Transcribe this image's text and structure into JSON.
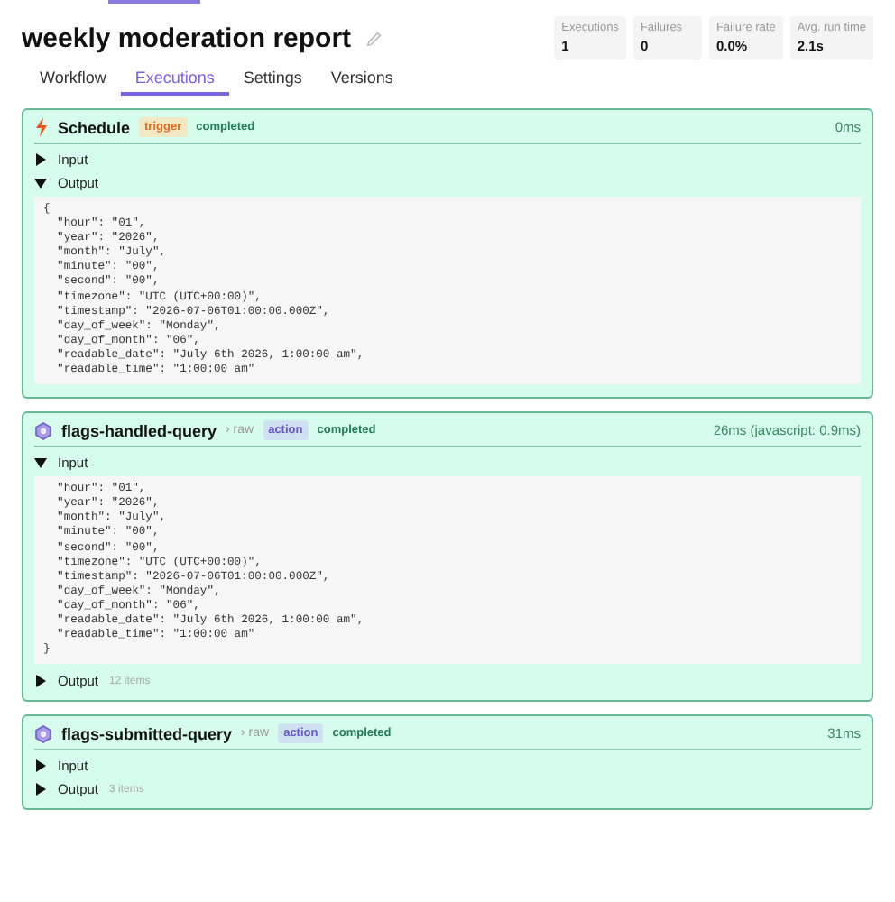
{
  "title": "weekly moderation report",
  "stats": [
    {
      "label": "Executions",
      "value": "1"
    },
    {
      "label": "Failures",
      "value": "0"
    },
    {
      "label": "Failure rate",
      "value": "0.0%"
    },
    {
      "label": "Avg. run time",
      "value": "2.1s"
    }
  ],
  "tabs": [
    {
      "label": "Workflow",
      "selected": false
    },
    {
      "label": "Executions",
      "selected": true
    },
    {
      "label": "Settings",
      "selected": false
    },
    {
      "label": "Versions",
      "selected": false
    }
  ],
  "steps": [
    {
      "kind": "trigger",
      "name": "Schedule",
      "badge": "trigger",
      "status": "completed",
      "duration": "0ms",
      "sections": [
        {
          "label": "Input",
          "expanded": false
        },
        {
          "label": "Output",
          "expanded": true,
          "code": [
            "{",
            "  \"hour\": \"01\",",
            "  \"year\": \"2026\",",
            "  \"month\": \"July\",",
            "  \"minute\": \"00\",",
            "  \"second\": \"00\",",
            "  \"timezone\": \"UTC (UTC+00:00)\",",
            "  \"timestamp\": \"2026-07-06T01:00:00.000Z\",",
            "  \"day_of_week\": \"Monday\",",
            "  \"day_of_month\": \"06\",",
            "  \"readable_date\": \"July 6th 2026, 1:00:00 am\",",
            "  \"readable_time\": \"1:00:00 am\""
          ]
        }
      ]
    },
    {
      "kind": "action",
      "name": "flags-handled-query",
      "raw": "› raw",
      "badge": "action",
      "status": "completed",
      "duration": "26ms (javascript: 0.9ms)",
      "sections": [
        {
          "label": "Input",
          "expanded": true,
          "code": [
            "  \"hour\": \"01\",",
            "  \"year\": \"2026\",",
            "  \"month\": \"July\",",
            "  \"minute\": \"00\",",
            "  \"second\": \"00\",",
            "  \"timezone\": \"UTC (UTC+00:00)\",",
            "  \"timestamp\": \"2026-07-06T01:00:00.000Z\",",
            "  \"day_of_week\": \"Monday\",",
            "  \"day_of_month\": \"06\",",
            "  \"readable_date\": \"July 6th 2026, 1:00:00 am\",",
            "  \"readable_time\": \"1:00:00 am\"",
            "}"
          ]
        },
        {
          "label": "Output",
          "expanded": false,
          "count": "12 items"
        }
      ]
    },
    {
      "kind": "action",
      "name": "flags-submitted-query",
      "raw": "› raw",
      "badge": "action",
      "status": "completed",
      "duration": "31ms",
      "sections": [
        {
          "label": "Input",
          "expanded": false
        },
        {
          "label": "Output",
          "expanded": false,
          "count": "3 items"
        }
      ]
    }
  ]
}
